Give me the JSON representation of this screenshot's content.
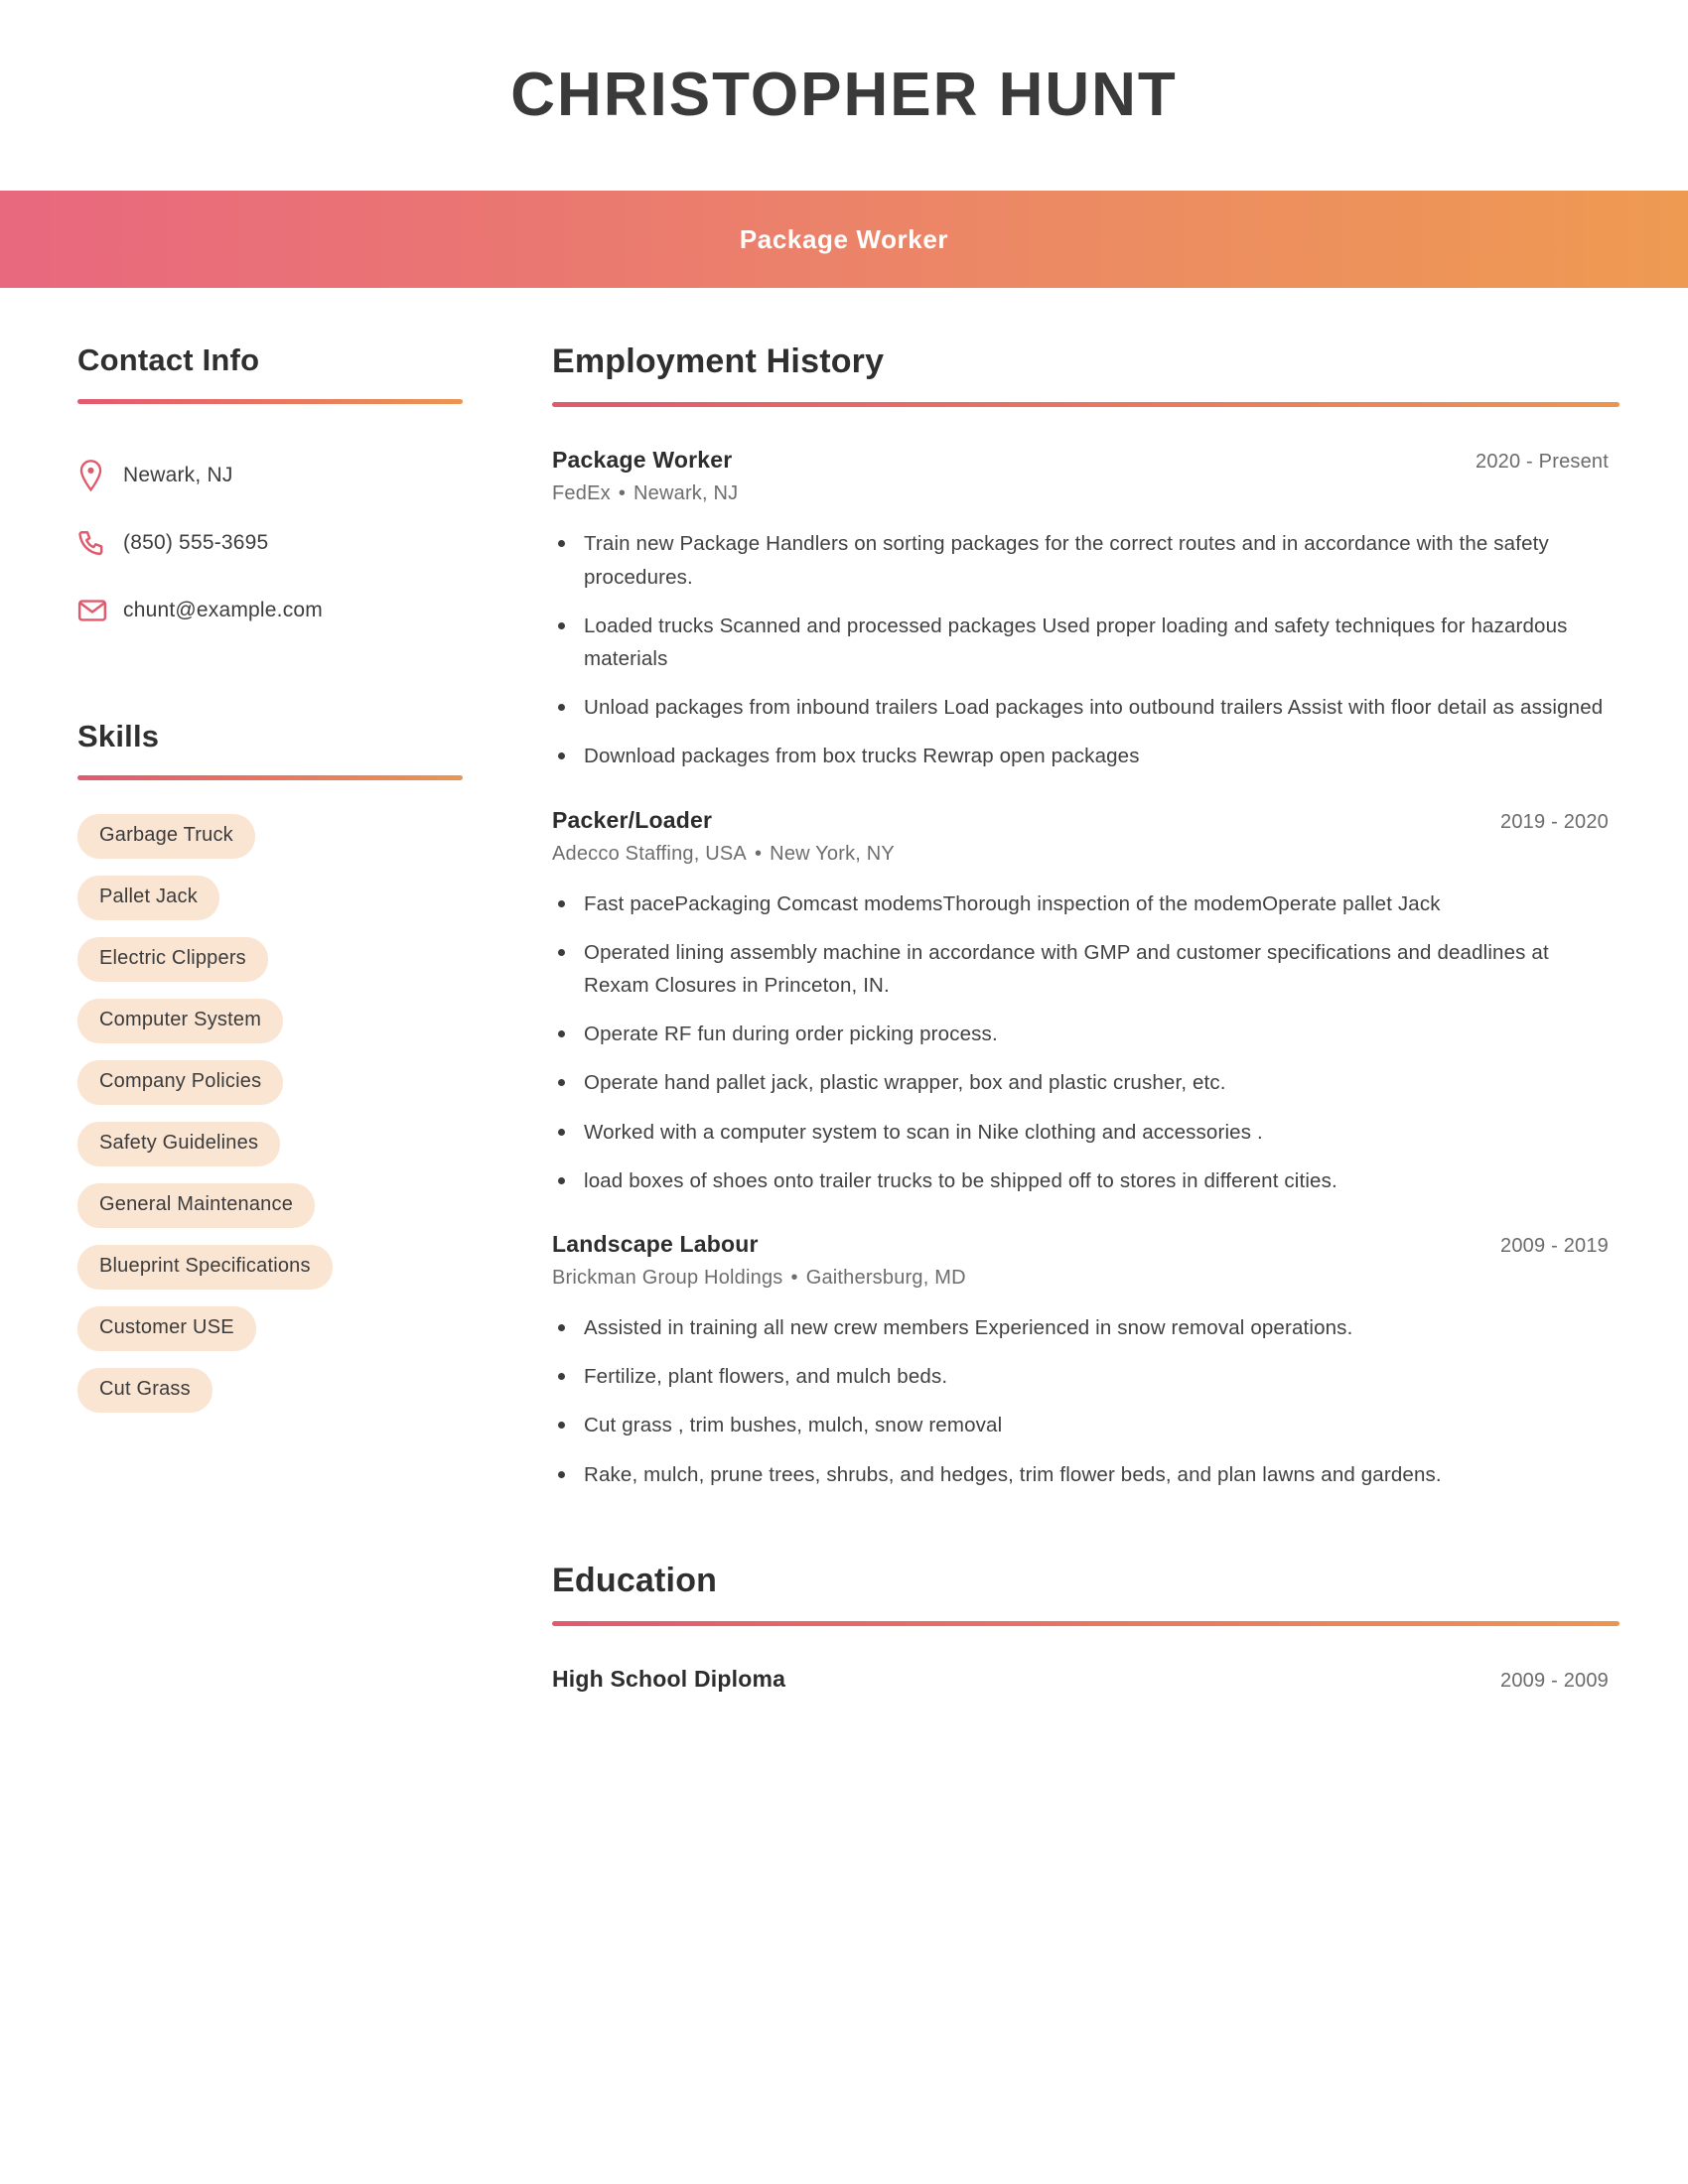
{
  "header": {
    "name": "CHRISTOPHER HUNT",
    "job_title": "Package Worker"
  },
  "theme": {
    "gradient_start": "#e8687e",
    "gradient_end": "#ee9a52",
    "icon_color": "#e05a6e",
    "chip_background": "#fae4d2",
    "heading_color": "#2f2f2f",
    "body_text_color": "#414141",
    "muted_text_color": "#6b6b6b"
  },
  "sidebar": {
    "contact": {
      "heading": "Contact Info",
      "items": [
        {
          "icon": "location-pin-icon",
          "value": "Newark, NJ"
        },
        {
          "icon": "phone-icon",
          "value": "(850) 555-3695"
        },
        {
          "icon": "envelope-icon",
          "value": "chunt@example.com"
        }
      ]
    },
    "skills": {
      "heading": "Skills",
      "items": [
        "Garbage Truck",
        "Pallet Jack",
        "Electric Clippers",
        "Computer System",
        "Company Policies",
        "Safety Guidelines",
        "General Maintenance",
        "Blueprint Specifications",
        "Customer USE",
        "Cut Grass"
      ]
    }
  },
  "main": {
    "employment": {
      "heading": "Employment History",
      "jobs": [
        {
          "title": "Package Worker",
          "dates": "2020 - Present",
          "company": "FedEx",
          "location": "Newark, NJ",
          "bullets": [
            "Train new Package Handlers on sorting packages for the correct routes and in accordance with the safety procedures.",
            "Loaded trucks Scanned and processed packages Used proper loading and safety techniques for hazardous materials",
            "Unload packages from inbound trailers Load packages into outbound trailers Assist with floor detail as assigned",
            "Download packages from box trucks Rewrap open packages"
          ]
        },
        {
          "title": "Packer/Loader",
          "dates": "2019 - 2020",
          "company": "Adecco Staffing, USA",
          "location": "New York, NY",
          "bullets": [
            "Fast pacePackaging Comcast modemsThorough inspection of the modemOperate pallet Jack",
            "Operated lining assembly machine in accordance with GMP and customer specifications and deadlines at Rexam Closures in Princeton, IN.",
            "Operate RF fun during order picking process.",
            "Operate hand pallet jack, plastic wrapper, box and plastic crusher, etc.",
            "Worked with a computer system to scan in Nike clothing and accessories .",
            "load boxes of shoes onto trailer trucks to be shipped off to stores in different cities."
          ]
        },
        {
          "title": "Landscape Labour",
          "dates": "2009 - 2019",
          "company": "Brickman Group Holdings",
          "location": "Gaithersburg, MD",
          "bullets": [
            "Assisted in training all new crew members Experienced in snow removal operations.",
            "Fertilize, plant flowers, and mulch beds.",
            "Cut grass , trim bushes, mulch, snow removal",
            "Rake, mulch, prune trees, shrubs, and hedges, trim flower beds, and plan lawns and gardens."
          ]
        }
      ]
    },
    "education": {
      "heading": "Education",
      "entries": [
        {
          "degree": "High School Diploma",
          "dates": "2009 - 2009"
        }
      ]
    }
  },
  "separator_bullet": "•"
}
